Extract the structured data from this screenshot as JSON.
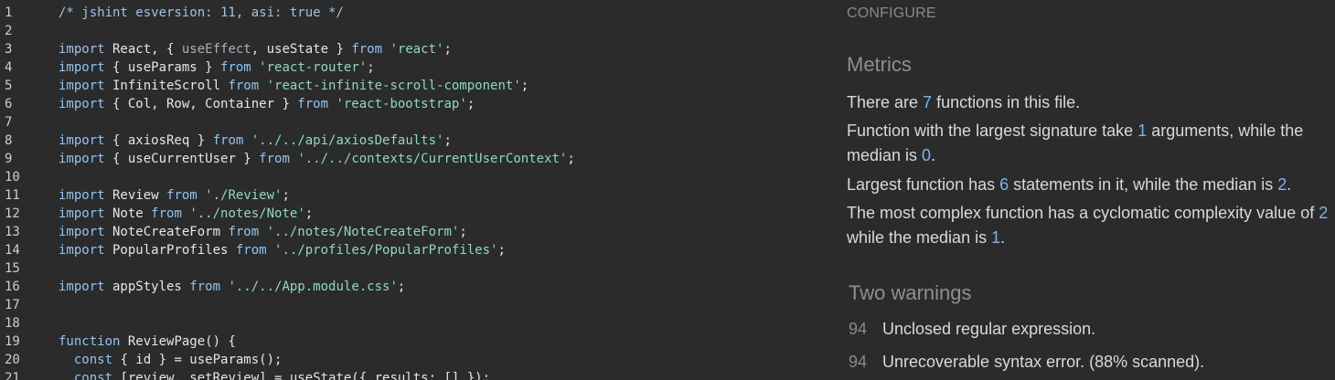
{
  "editor": {
    "lines": [
      {
        "n": "1",
        "tokens": [
          {
            "t": "/* jshint esversion: 11, asi: true */",
            "c": "cm"
          }
        ]
      },
      {
        "n": "2",
        "tokens": []
      },
      {
        "n": "3",
        "tokens": [
          {
            "t": "import",
            "c": "kw"
          },
          {
            "t": " React, { ",
            "c": "pl"
          },
          {
            "t": "useEffect",
            "c": "dim"
          },
          {
            "t": ", useState } ",
            "c": "pl"
          },
          {
            "t": "from",
            "c": "kw"
          },
          {
            "t": " ",
            "c": "pl"
          },
          {
            "t": "'react'",
            "c": "str"
          },
          {
            "t": ";",
            "c": "pl"
          }
        ]
      },
      {
        "n": "4",
        "tokens": [
          {
            "t": "import",
            "c": "kw"
          },
          {
            "t": " { useParams } ",
            "c": "pl"
          },
          {
            "t": "from",
            "c": "kw"
          },
          {
            "t": " ",
            "c": "pl"
          },
          {
            "t": "'react-router'",
            "c": "str"
          },
          {
            "t": ";",
            "c": "pl"
          }
        ]
      },
      {
        "n": "5",
        "tokens": [
          {
            "t": "import",
            "c": "kw"
          },
          {
            "t": " InfiniteScroll ",
            "c": "pl"
          },
          {
            "t": "from",
            "c": "kw"
          },
          {
            "t": " ",
            "c": "pl"
          },
          {
            "t": "'react-infinite-scroll-component'",
            "c": "str"
          },
          {
            "t": ";",
            "c": "pl"
          }
        ]
      },
      {
        "n": "6",
        "tokens": [
          {
            "t": "import",
            "c": "kw"
          },
          {
            "t": " { Col, Row, Container } ",
            "c": "pl"
          },
          {
            "t": "from",
            "c": "kw"
          },
          {
            "t": " ",
            "c": "pl"
          },
          {
            "t": "'react-bootstrap'",
            "c": "str"
          },
          {
            "t": ";",
            "c": "pl"
          }
        ]
      },
      {
        "n": "7",
        "tokens": []
      },
      {
        "n": "8",
        "tokens": [
          {
            "t": "import",
            "c": "kw"
          },
          {
            "t": " { axiosReq } ",
            "c": "pl"
          },
          {
            "t": "from",
            "c": "kw"
          },
          {
            "t": " ",
            "c": "pl"
          },
          {
            "t": "'../../api/axiosDefaults'",
            "c": "str"
          },
          {
            "t": ";",
            "c": "pl"
          }
        ]
      },
      {
        "n": "9",
        "tokens": [
          {
            "t": "import",
            "c": "kw"
          },
          {
            "t": " { useCurrentUser } ",
            "c": "pl"
          },
          {
            "t": "from",
            "c": "kw"
          },
          {
            "t": " ",
            "c": "pl"
          },
          {
            "t": "'../../contexts/CurrentUserContext'",
            "c": "str"
          },
          {
            "t": ";",
            "c": "pl"
          }
        ]
      },
      {
        "n": "10",
        "tokens": []
      },
      {
        "n": "11",
        "tokens": [
          {
            "t": "import",
            "c": "kw"
          },
          {
            "t": " Review ",
            "c": "pl"
          },
          {
            "t": "from",
            "c": "kw"
          },
          {
            "t": " ",
            "c": "pl"
          },
          {
            "t": "'./Review'",
            "c": "str"
          },
          {
            "t": ";",
            "c": "pl"
          }
        ]
      },
      {
        "n": "12",
        "tokens": [
          {
            "t": "import",
            "c": "kw"
          },
          {
            "t": " Note ",
            "c": "pl"
          },
          {
            "t": "from",
            "c": "kw"
          },
          {
            "t": " ",
            "c": "pl"
          },
          {
            "t": "'../notes/Note'",
            "c": "str"
          },
          {
            "t": ";",
            "c": "pl"
          }
        ]
      },
      {
        "n": "13",
        "tokens": [
          {
            "t": "import",
            "c": "kw"
          },
          {
            "t": " NoteCreateForm ",
            "c": "pl"
          },
          {
            "t": "from",
            "c": "kw"
          },
          {
            "t": " ",
            "c": "pl"
          },
          {
            "t": "'../notes/NoteCreateForm'",
            "c": "str"
          },
          {
            "t": ";",
            "c": "pl"
          }
        ]
      },
      {
        "n": "14",
        "tokens": [
          {
            "t": "import",
            "c": "kw"
          },
          {
            "t": " PopularProfiles ",
            "c": "pl"
          },
          {
            "t": "from",
            "c": "kw"
          },
          {
            "t": " ",
            "c": "pl"
          },
          {
            "t": "'../profiles/PopularProfiles'",
            "c": "str"
          },
          {
            "t": ";",
            "c": "pl"
          }
        ]
      },
      {
        "n": "15",
        "tokens": []
      },
      {
        "n": "16",
        "tokens": [
          {
            "t": "import",
            "c": "kw"
          },
          {
            "t": " appStyles ",
            "c": "pl"
          },
          {
            "t": "from",
            "c": "kw"
          },
          {
            "t": " ",
            "c": "pl"
          },
          {
            "t": "'../../App.module.css'",
            "c": "str"
          },
          {
            "t": ";",
            "c": "pl"
          }
        ]
      },
      {
        "n": "17",
        "tokens": []
      },
      {
        "n": "18",
        "tokens": []
      },
      {
        "n": "19",
        "tokens": [
          {
            "t": "function",
            "c": "kw"
          },
          {
            "t": " ReviewPage() {",
            "c": "pl"
          }
        ]
      },
      {
        "n": "20",
        "tokens": [
          {
            "t": "  ",
            "c": "pl"
          },
          {
            "t": "const",
            "c": "kw"
          },
          {
            "t": " { id } = useParams();",
            "c": "pl"
          }
        ]
      },
      {
        "n": "21",
        "tokens": [
          {
            "t": "  ",
            "c": "pl"
          },
          {
            "t": "const",
            "c": "kw"
          },
          {
            "t": " [review, setReview] = useState({ results: [] });",
            "c": "pl"
          }
        ]
      }
    ]
  },
  "panel": {
    "configure_label": "CONFIGURE",
    "metrics_title": "Metrics",
    "metrics": {
      "p1": {
        "a": "There are ",
        "n1": "7",
        "b": " functions in this file."
      },
      "p2": {
        "a": "Function with the largest signature take ",
        "n1": "1",
        "b": " arguments, while the median is ",
        "n2": "0",
        "c": "."
      },
      "p3": {
        "a": "Largest function has ",
        "n1": "6",
        "b": " statements in it, while the median is ",
        "n2": "2",
        "c": "."
      },
      "p4": {
        "a": "The most complex function has a cyclomatic complexity value of ",
        "n1": "2",
        "b": " while the median is ",
        "n2": "1",
        "c": "."
      }
    },
    "warnings_title": "Two warnings",
    "warnings": [
      {
        "line": "94",
        "message": "Unclosed regular expression."
      },
      {
        "line": "94",
        "message": "Unrecoverable syntax error. (88% scanned)."
      }
    ]
  },
  "colors": {
    "background": "#2b2b2b",
    "keyword": "#93c4f0",
    "string": "#8ed8c8",
    "number_highlight": "#7db4ec"
  }
}
